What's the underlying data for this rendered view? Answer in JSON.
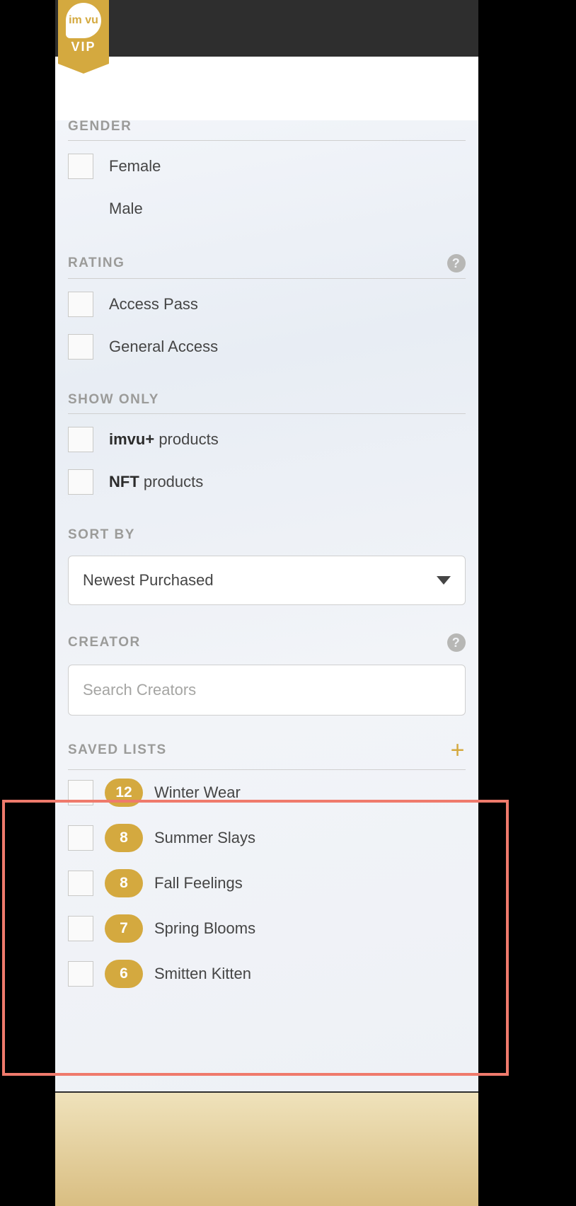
{
  "vip_label": "VIP",
  "vip_logo_text": "im\nvu",
  "gender_heading": "GENDER",
  "gender": [
    {
      "label": "Female"
    },
    {
      "label": "Male"
    }
  ],
  "rating_heading": "RATING",
  "rating": [
    {
      "label": "Access Pass"
    },
    {
      "label": "General Access"
    }
  ],
  "show_only_heading": "SHOW ONLY",
  "show_only": [
    {
      "bold": "imvu+",
      "rest": " products"
    },
    {
      "bold": "NFT",
      "rest": " products"
    }
  ],
  "sort_by_heading": "SORT BY",
  "sort_by_value": "Newest Purchased",
  "creator_heading": "CREATOR",
  "creator_placeholder": "Search Creators",
  "saved_lists_heading": "SAVED LISTS",
  "saved_lists": [
    {
      "count": "12",
      "label": "Winter Wear"
    },
    {
      "count": "8",
      "label": "Summer Slays"
    },
    {
      "count": "8",
      "label": "Fall Feelings"
    },
    {
      "count": "7",
      "label": "Spring Blooms"
    },
    {
      "count": "6",
      "label": "Smitten Kitten"
    }
  ],
  "help_glyph": "?",
  "plus_glyph": "+"
}
